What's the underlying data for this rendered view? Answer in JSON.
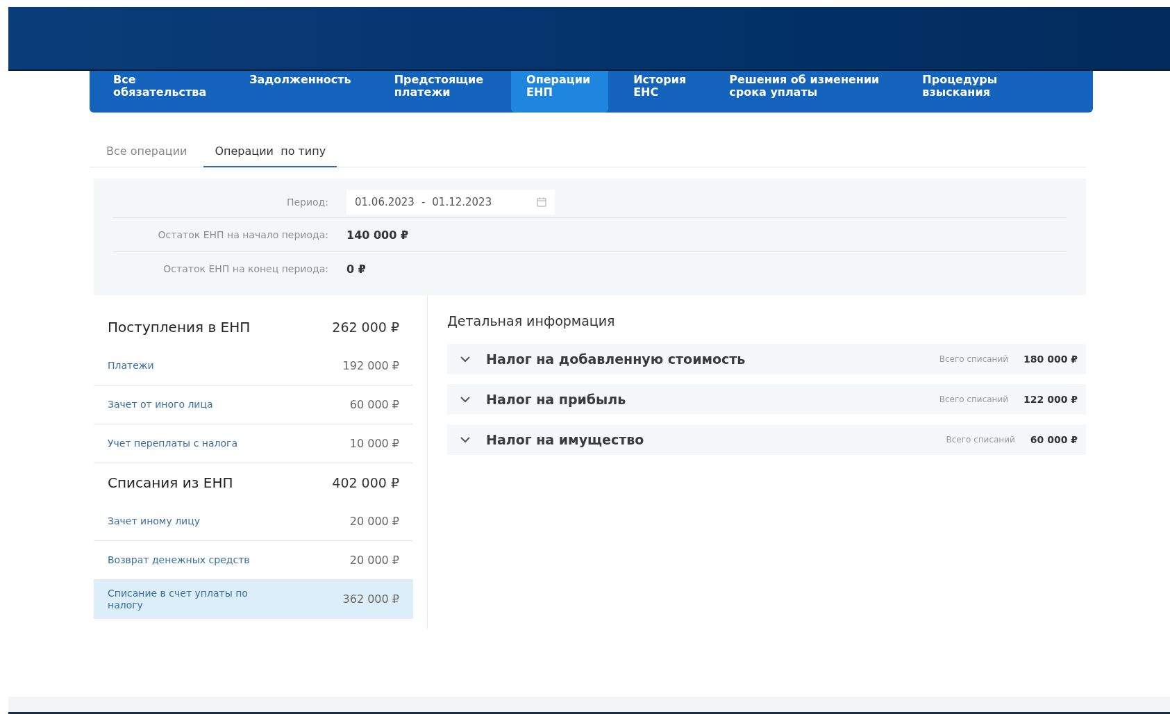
{
  "nav_tabs": [
    {
      "label": "Все\nобязательства",
      "selected": false
    },
    {
      "label": "Задолженность",
      "selected": false
    },
    {
      "label": "Предстоящие\nплатежи",
      "selected": false
    },
    {
      "label": "Операции\nЕНП",
      "selected": true
    },
    {
      "label": "История\nЕНС",
      "selected": false
    },
    {
      "label": "Решения об изменении\nсрока уплаты",
      "selected": false
    },
    {
      "label": "Процедуры\nвзыскания",
      "selected": false
    }
  ],
  "sub_tabs": [
    {
      "label": "Все операции",
      "selected": false
    },
    {
      "label": "Операции  по типу",
      "selected": true
    }
  ],
  "filter": {
    "period_label": "Период:",
    "date_from": "01.06.2023",
    "date_separator": "-",
    "date_to": "01.12.2023",
    "balances": [
      {
        "label": "Остаток ЕНП на начало периода:",
        "value": "140 000 ₽"
      },
      {
        "label": "Остаток ЕНП на конец периода:",
        "value": "0 ₽"
      }
    ]
  },
  "operations": [
    {
      "kind": "header",
      "label": "Поступления в ЕНП",
      "amount": "262 000 ₽"
    },
    {
      "kind": "item",
      "label": "Платежи",
      "amount": "192 000 ₽",
      "selected": false
    },
    {
      "kind": "item",
      "label": "Зачет от иного лица",
      "amount": "60 000 ₽",
      "selected": false
    },
    {
      "kind": "item",
      "label": "Учет переплаты с налога",
      "amount": "10 000 ₽",
      "selected": false
    },
    {
      "kind": "header",
      "label": "Списания из ЕНП",
      "amount": "402 000 ₽"
    },
    {
      "kind": "item",
      "label": "Зачет иному лицу",
      "amount": "20 000 ₽",
      "selected": false
    },
    {
      "kind": "item",
      "label": "Возврат денежных средств",
      "amount": "20 000 ₽",
      "selected": false
    },
    {
      "kind": "item",
      "label": "Списание в счет уплаты по налогу",
      "amount": "362 000 ₽",
      "selected": true
    }
  ],
  "details": {
    "title": "Детальная информация",
    "items": [
      {
        "name": "Налог на добавленную стоимость",
        "total_label": "Всего списаний",
        "total": "180 000 ₽",
        "expanded": false
      },
      {
        "name": "Налог на прибыль",
        "total_label": "Всего списаний",
        "total": "122 000 ₽",
        "expanded": false
      },
      {
        "name": "Налог на имущество",
        "total_label": "Всего списаний",
        "total": "60 000 ₽",
        "expanded": false
      }
    ]
  }
}
